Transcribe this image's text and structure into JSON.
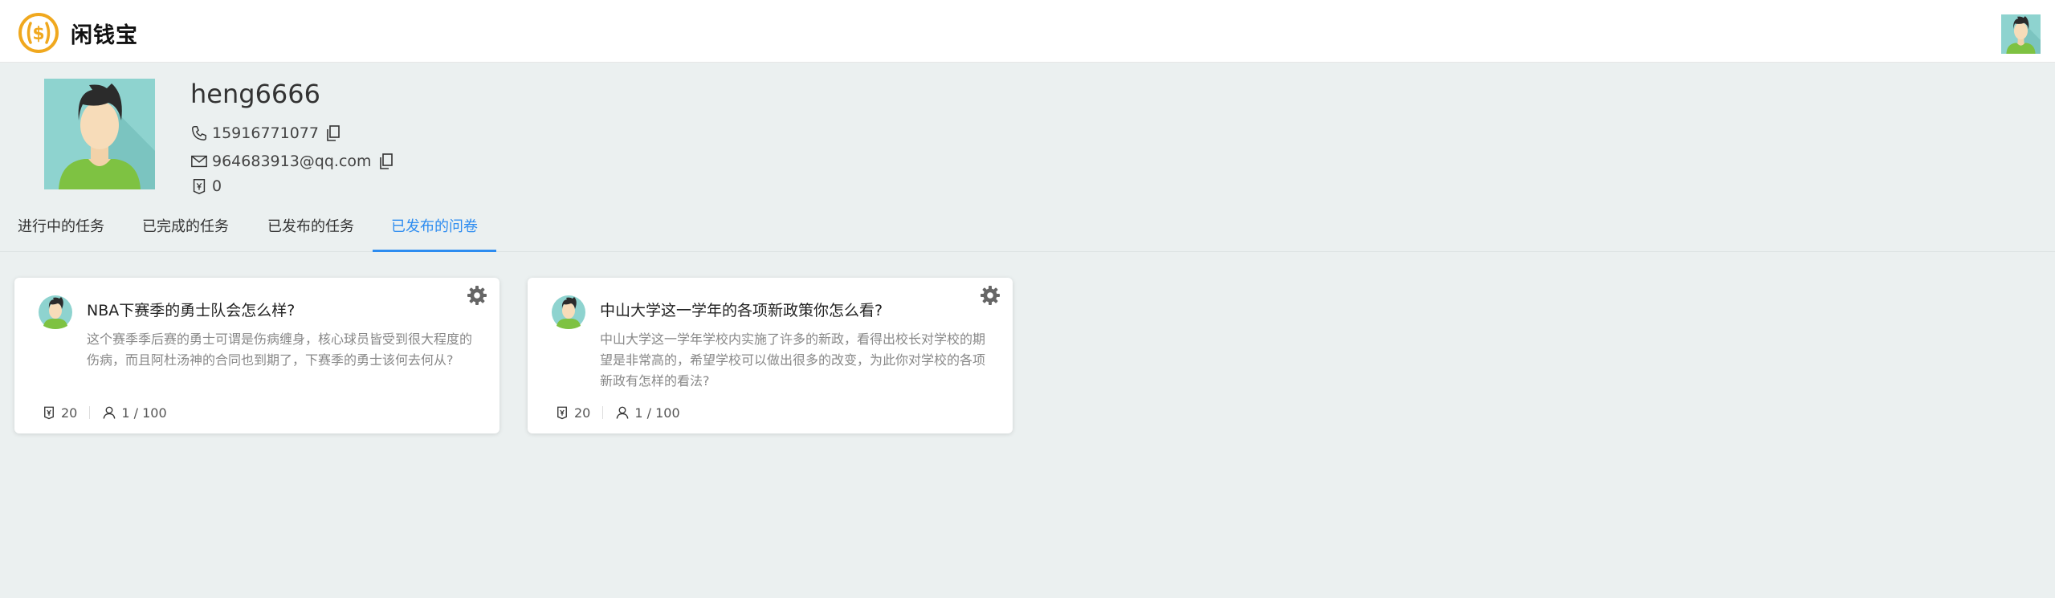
{
  "header": {
    "logo_text": "闲钱宝",
    "logo_icon": "dollar-coin-icon"
  },
  "profile": {
    "username": "heng6666",
    "phone": "15916771077",
    "email": "964683913@qq.com",
    "coins": "0"
  },
  "tabs": [
    {
      "label": "进行中的任务",
      "active": false
    },
    {
      "label": "已完成的任务",
      "active": false
    },
    {
      "label": "已发布的任务",
      "active": false
    },
    {
      "label": "已发布的问卷",
      "active": true
    }
  ],
  "surveys": [
    {
      "title": "NBA下赛季的勇士队会怎么样?",
      "description": "这个赛季季后赛的勇士可谓是伤病缠身，核心球员皆受到很大程度的伤病，而且阿杜汤神的合同也到期了，下赛季的勇士该何去何从?",
      "reward": "20",
      "progress": "1 / 100"
    },
    {
      "title": "中山大学这一学年的各项新政策你怎么看?",
      "description": "中山大学这一学年学校内实施了许多的新政，看得出校长对学校的期望是非常高的，希望学校可以做出很多的改变，为此你对学校的各项新政有怎样的看法?",
      "reward": "20",
      "progress": "1 / 100"
    }
  ],
  "colors": {
    "accent": "#2d8cf0",
    "logo": "#f0a81e",
    "background": "#ebf0f0"
  }
}
